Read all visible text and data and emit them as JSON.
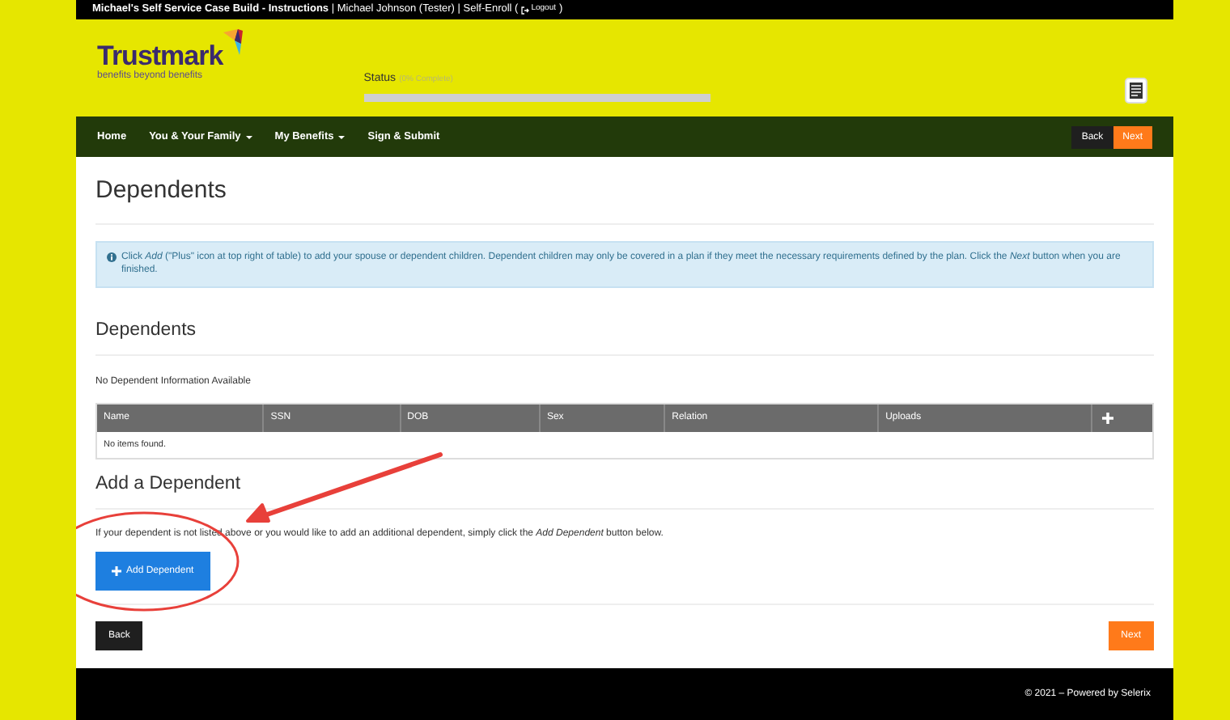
{
  "top_bar": {
    "lead": "**Michael's Self Service Case Build - Instructions** | Michael Johnson (Tester) | Self-Enroll (",
    "logout": "Logout",
    "tail": ")"
  },
  "logo": {
    "name": "Trustmark",
    "tagline": "benefits beyond benefits"
  },
  "status": {
    "label": "Status",
    "detail": "(0% Complete)",
    "level": 0
  },
  "nav": {
    "items": [
      {
        "label": "Home",
        "dropdown": false
      },
      {
        "label": "You & Your Family",
        "dropdown": true
      },
      {
        "label": "My Benefits",
        "dropdown": true
      },
      {
        "label": "Sign & Submit",
        "dropdown": false
      }
    ],
    "back": "Back",
    "next": "Next"
  },
  "page_title": "Dependents",
  "alert": "Click *Add* (\"Plus\" icon at top right of table) to add your spouse or dependent children. Dependent children may only be covered in a plan if they meet the necessary requirements defined by the plan. Click the *Next* button when you are finished.",
  "dependents": {
    "title": "Dependents",
    "empty_message": "No Dependent Information Available",
    "table": {
      "columns": [
        "Name",
        "SSN",
        "DOB",
        "Sex",
        "Relation",
        "Uploads"
      ],
      "empty_row": "No items found."
    }
  },
  "add_section": {
    "title": "Add a Dependent",
    "text": "If your dependent is not listed above or you would like to add an additional dependent, simply click the *Add Dependent* button below.",
    "button": "Add Dependent"
  },
  "footer_buttons": {
    "back": "Back",
    "next": "Next"
  },
  "footer": "© 2021 – Powered by Selerix"
}
